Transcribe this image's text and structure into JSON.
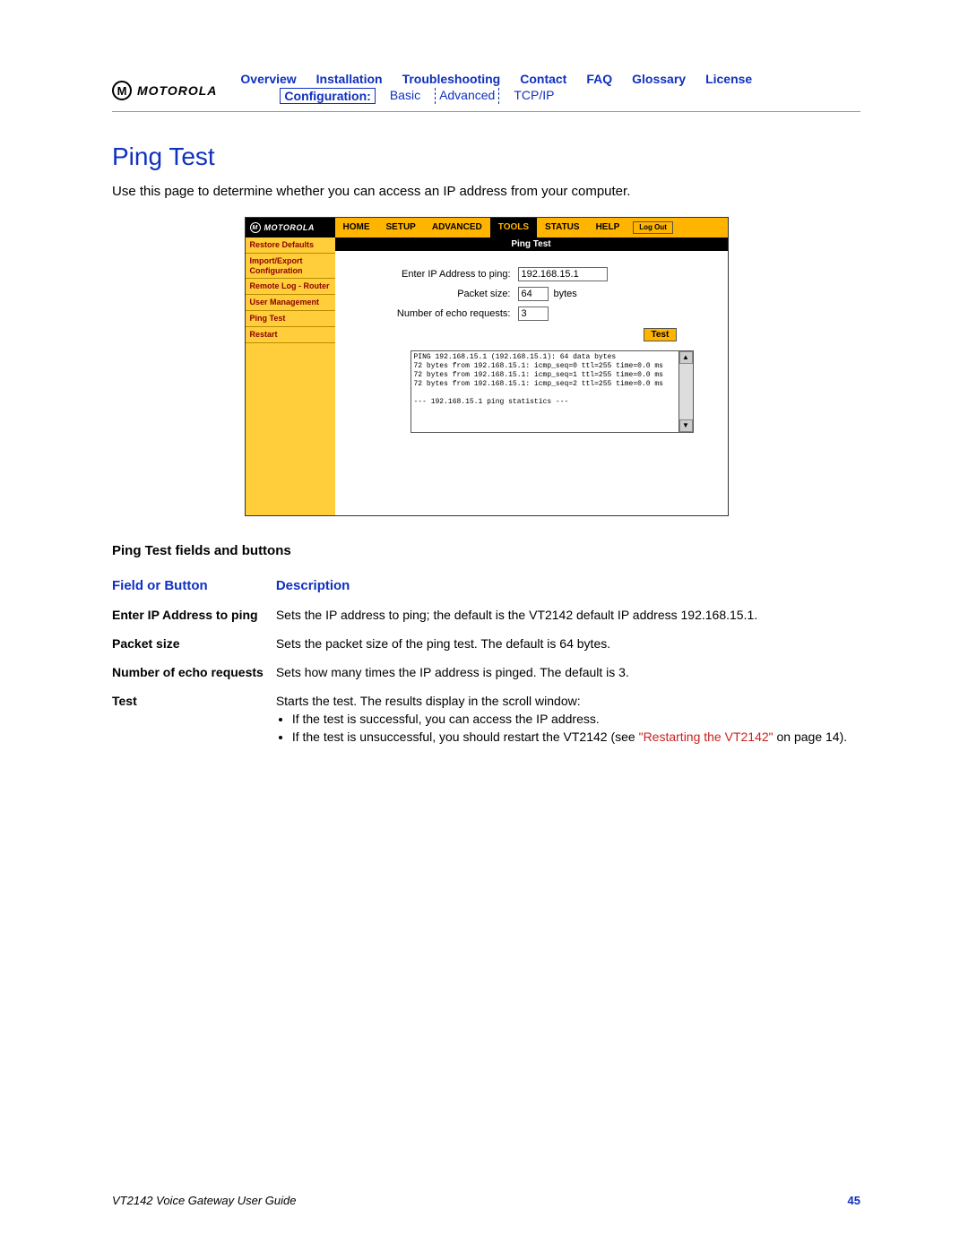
{
  "logo_text": "MOTOROLA",
  "nav": {
    "row1": [
      "Overview",
      "Installation",
      "Troubleshooting",
      "Contact",
      "FAQ",
      "Glossary",
      "License"
    ],
    "config_label": "Configuration:",
    "basic": "Basic",
    "advanced": "Advanced",
    "tcpip": "TCP/IP"
  },
  "title": "Ping Test",
  "intro": "Use this page to determine whether you can access an IP address from your computer.",
  "router": {
    "logo": "MOTOROLA",
    "tabs": [
      "HOME",
      "SETUP",
      "ADVANCED",
      "TOOLS",
      "STATUS",
      "HELP"
    ],
    "active_tab": "TOOLS",
    "logout": "Log Out",
    "sidebar": [
      "Restore Defaults",
      "Import/Export Configuration",
      "Remote Log - Router",
      "User Management",
      "Ping Test",
      "Restart"
    ],
    "banner": "Ping Test",
    "form": {
      "ip_label": "Enter IP Address to ping:",
      "ip_value": "192.168.15.1",
      "pkt_label": "Packet size:",
      "pkt_value": "64",
      "bytes": "bytes",
      "echo_label": "Number of echo requests:",
      "echo_value": "3",
      "test_btn": "Test"
    },
    "results": "PING 192.168.15.1 (192.168.15.1): 64 data bytes\n72 bytes from 192.168.15.1: icmp_seq=0 ttl=255 time=0.0 ms\n72 bytes from 192.168.15.1: icmp_seq=1 ttl=255 time=0.0 ms\n72 bytes from 192.168.15.1: icmp_seq=2 ttl=255 time=0.0 ms\n\n--- 192.168.15.1 ping statistics ---"
  },
  "section_head": "Ping Test fields and buttons",
  "table": {
    "col1": "Field or Button",
    "col2": "Description",
    "rows": [
      {
        "f": "Enter IP Address to ping",
        "d": "Sets the IP address to ping; the default is the VT2142 default IP address 192.168.15.1."
      },
      {
        "f": "Packet size",
        "d": "Sets the packet size of the ping test. The default is 64 bytes."
      },
      {
        "f": "Number of echo requests",
        "d": "Sets how many times the IP address is pinged. The default is 3."
      }
    ],
    "testrow": {
      "f": "Test",
      "lead": "Starts the test. The results display in the scroll window:",
      "b1": "If the test is successful, you can access the IP address.",
      "b2a": "If the test is unsuccessful, you should restart the VT2142 (see ",
      "b2link": "\"Restarting the VT2142\"",
      "b2b": " on page 14)."
    }
  },
  "footer": {
    "guide": "VT2142 Voice Gateway User Guide",
    "page": "45"
  }
}
